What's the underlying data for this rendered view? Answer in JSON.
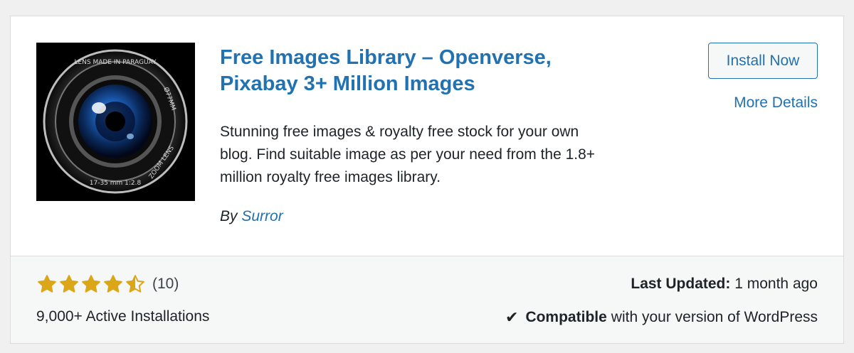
{
  "plugin": {
    "title_line1": "Free Images Library – Openverse,",
    "title_line2": "Pixabay 3+ Million Images",
    "description_line1": "Stunning free images & royalty free stock for your own",
    "description_line2": "blog. Find suitable image as per your need from the 1.8+",
    "description_line3": "million royalty free images library.",
    "by_label": "By",
    "author": "Surror",
    "thumbnail_icon": "camera-lens-icon",
    "thumbnail_text_top": "LENS MADE IN PARAGUAY",
    "thumbnail_text_side": "Ø77MM",
    "thumbnail_text_right": "ZOOM LENS",
    "thumbnail_text_bottom": "17-35 mm 1:2.8"
  },
  "actions": {
    "install_label": "Install Now",
    "more_details_label": "More Details"
  },
  "footer": {
    "rating": 4.5,
    "rating_max": 5,
    "rating_count": "(10)",
    "active_installs": "9,000+ Active Installations",
    "last_updated_label": "Last Updated:",
    "last_updated_value": "1 month ago",
    "compat_icon": "✔",
    "compat_strong": "Compatible",
    "compat_rest": "with your version of WordPress"
  },
  "colors": {
    "link": "#2271b1",
    "star": "#dba617",
    "text": "#1d2327"
  }
}
